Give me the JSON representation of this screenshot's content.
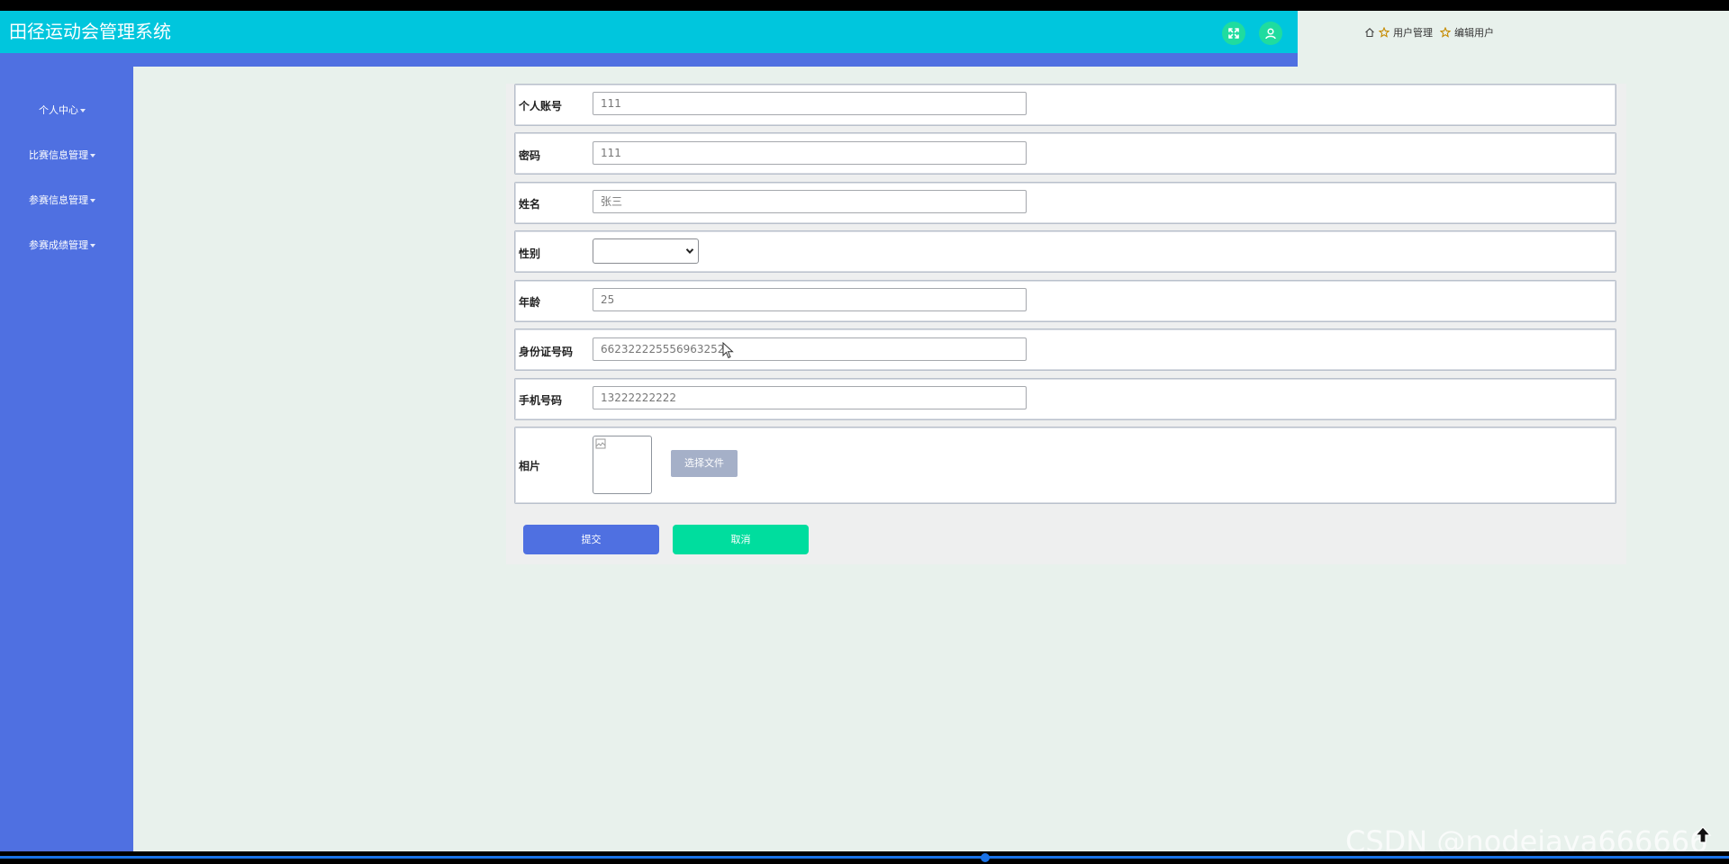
{
  "app": {
    "title": "田径运动会管理系统"
  },
  "header": {
    "fullscreen_icon": "expand-arrows-icon",
    "user_icon": "user-icon",
    "accent_color": "#00c6dd",
    "button_color": "#1fdc9f"
  },
  "breadcrumb": {
    "home_icon": "home-icon",
    "items": [
      "用户管理",
      "编辑用户"
    ]
  },
  "sidebar": {
    "color": "#4f70e1",
    "items": [
      {
        "label": "个人中心"
      },
      {
        "label": "比赛信息管理"
      },
      {
        "label": "参赛信息管理"
      },
      {
        "label": "参赛成绩管理"
      }
    ]
  },
  "form": {
    "account": {
      "label": "个人账号",
      "value": "111"
    },
    "password": {
      "label": "密码",
      "value": "111"
    },
    "name": {
      "label": "姓名",
      "value": "张三"
    },
    "gender": {
      "label": "性别",
      "value": ""
    },
    "age": {
      "label": "年龄",
      "value": "25"
    },
    "id_number": {
      "label": "身份证号码",
      "value": "662322225556963252"
    },
    "phone": {
      "label": "手机号码",
      "value": "13222222222"
    },
    "photo": {
      "label": "相片",
      "choose_file_label": "选择文件"
    },
    "submit_label": "提交",
    "cancel_label": "取消",
    "submit_color": "#4f70e1",
    "cancel_color": "#00dd9e"
  },
  "watermark": "CSDN @nodejava666666"
}
